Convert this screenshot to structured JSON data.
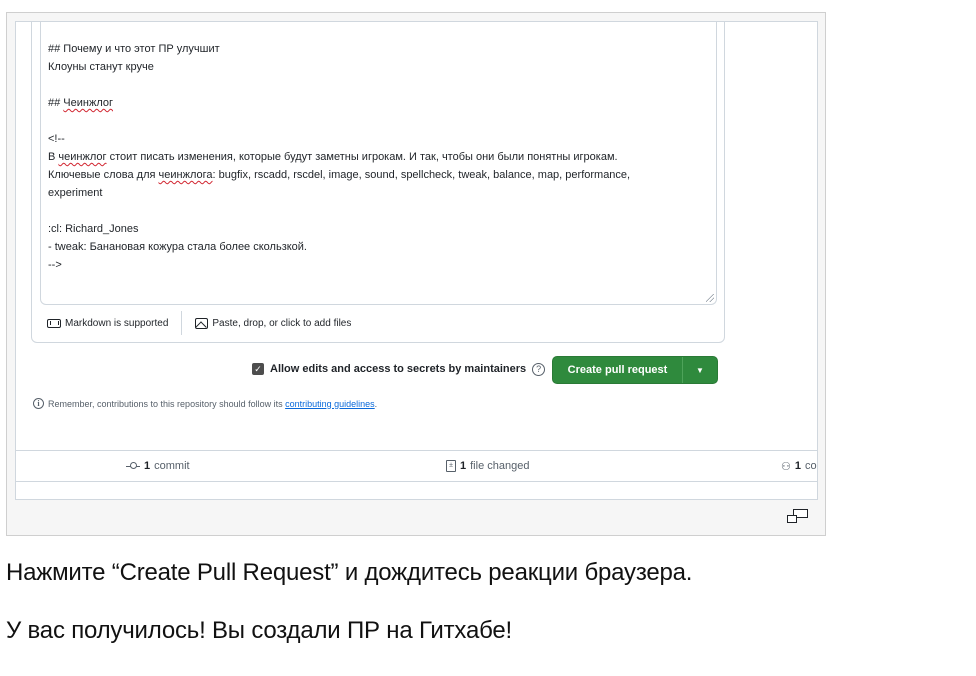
{
  "textarea": {
    "lines": [
      {
        "text": "## Почему и что этот ПР улучшит"
      },
      {
        "text": "Клоуны станут круче"
      },
      {
        "prefix": "## ",
        "squiggle": "Чеинжлог",
        "suffix": ""
      },
      {
        "text": "<!--"
      },
      {
        "prefix": "В ",
        "squiggle": "чеинжлог",
        "suffix": " стоит писать изменения, которые будут заметны игрокам. И так, чтобы они были понятны игрокам."
      },
      {
        "prefix": "Ключевые слова для ",
        "squiggle": "чеинжлога",
        "suffix": ": bugfix, rscadd, rscdel, image, sound, spellcheck, tweak, balance, map, performance,"
      },
      {
        "text": "experiment"
      },
      {
        "text": ":cl: Richard_Jones"
      },
      {
        "text": " - tweak: Банановая кожура стала более скользкой."
      },
      {
        "text": "-->"
      }
    ]
  },
  "footer": {
    "markdown_label": "Markdown is supported",
    "attach_label": "Paste, drop, or click to add files"
  },
  "allow_edits": {
    "checked": true,
    "label": "Allow edits and access to secrets by maintainers"
  },
  "create_button": {
    "label": "Create pull request",
    "color": "#2f8a3d"
  },
  "remember": {
    "prefix": "Remember, contributions to this repository should follow its ",
    "link": "contributing guidelines",
    "suffix": "."
  },
  "stats": {
    "commits_count": "1",
    "commits_label": "commit",
    "files_count": "1",
    "files_label": "file changed",
    "contributors_count": "1",
    "contributors_label": "co"
  },
  "captions": {
    "first": "Нажмите “Create Pull Request” и дождитесь реакции браузера.",
    "second": "У вас получилось! Вы создали ПР на Гитхабе!"
  }
}
